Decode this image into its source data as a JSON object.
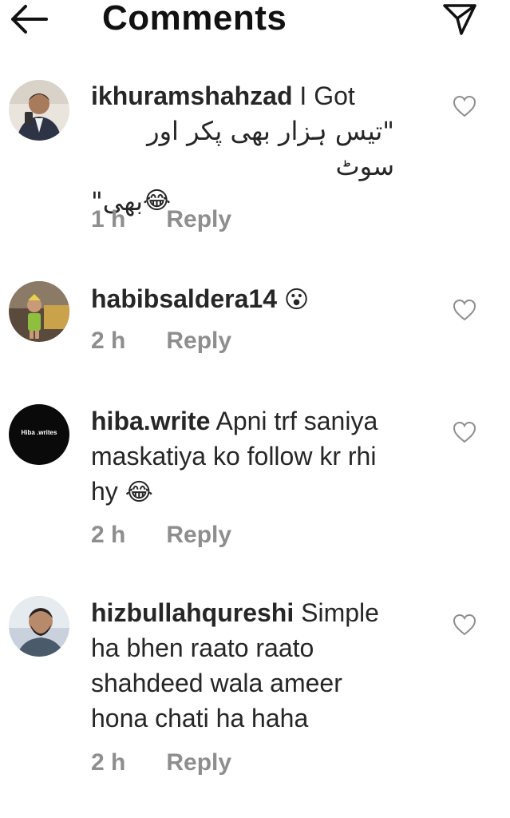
{
  "header": {
    "title": "Comments",
    "back_icon": "arrow-left-icon",
    "send_icon": "send-icon"
  },
  "comments": [
    {
      "username": "ikhuramshahzad",
      "text_line1": "I Got",
      "text_rtl1": "\"تیس ہزار بھی پکر اور سوٹ",
      "text_rtl2": "بھی\"",
      "emoji": "😂",
      "time": "1 h",
      "reply": "Reply"
    },
    {
      "username": "habibsaldera14",
      "text": "",
      "emoji": "😮",
      "time": "2 h",
      "reply": "Reply"
    },
    {
      "username": "hiba.write",
      "avatar_label": "Hiba .writes",
      "text_line1": "Apni trf saniya",
      "text_line2": "maskatiya ko follow kr rhi",
      "text_line3": "hy",
      "emoji": "😂",
      "time": "2 h",
      "reply": "Reply"
    },
    {
      "username": "hizbullahqureshi",
      "text_line1": "Simple",
      "text_line2": "ha bhen raato raato",
      "text_line3": "shahdeed wala ameer",
      "text_line4": "hona chati ha haha",
      "time": "2 h",
      "reply": "Reply"
    }
  ],
  "colors": {
    "text": "#262626",
    "muted": "#8e8e8e",
    "background": "#ffffff"
  }
}
